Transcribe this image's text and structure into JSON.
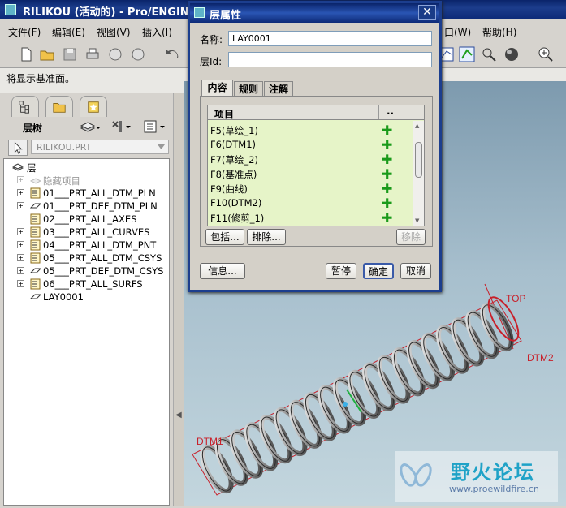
{
  "main_window": {
    "title": "RILIKOU (活动的) - Pro/ENGINEER"
  },
  "menubar": {
    "items": [
      "文件(F)",
      "编辑(E)",
      "视图(V)",
      "插入(I)",
      "口(W)",
      "帮助(H)"
    ]
  },
  "message": "将显示基准面。",
  "left_panel": {
    "tree_title": "层树",
    "part_selector": "RILIKOU.PRT",
    "root": "层",
    "items": [
      "隐藏项目",
      "01___PRT_ALL_DTM_PLN",
      "01___PRT_DEF_DTM_PLN",
      "02___PRT_ALL_AXES",
      "03___PRT_ALL_CURVES",
      "04___PRT_ALL_DTM_PNT",
      "05___PRT_ALL_DTM_CSYS",
      "05___PRT_DEF_DTM_CSYS",
      "06___PRT_ALL_SURFS",
      "LAY0001"
    ]
  },
  "dialog": {
    "title": "层属性",
    "name_label": "名称:",
    "name_value": "LAY0001",
    "id_label": "层Id:",
    "id_value": "",
    "tabs": [
      "内容",
      "规则",
      "注解"
    ],
    "list_header": "项目",
    "list_header_more": "..",
    "items": [
      "F5(草绘_1)",
      "F6(DTM1)",
      "F7(草绘_2)",
      "F8(基准点)",
      "F9(曲线)",
      "F10(DTM2)",
      "F11(修剪_1)"
    ],
    "include_label": "包括...",
    "exclude_label": "排除...",
    "remove_label": "移除",
    "info_label": "信息...",
    "pause_label": "暂停",
    "ok_label": "确定",
    "cancel_label": "取消"
  },
  "viewport": {
    "labels": {
      "top": "TOP",
      "dtm2": "DTM2",
      "dtm1": "DTM1"
    }
  },
  "watermark": {
    "brand": "野火论坛",
    "url": "www.proewildfire.cn"
  },
  "colors": {
    "titlebar": "#0a246a",
    "datum_red": "#c8202a",
    "list_bg": "#e6f4c8",
    "plus_green": "#1a9a1a"
  }
}
